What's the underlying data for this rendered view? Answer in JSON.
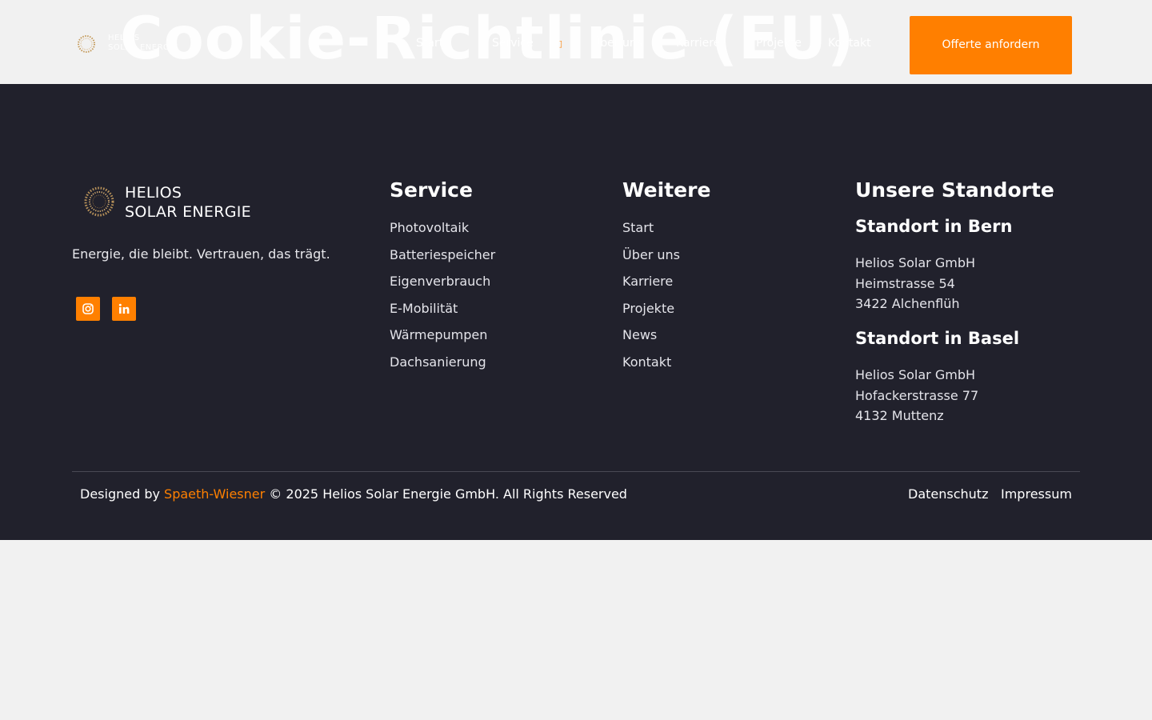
{
  "header": {
    "logo_text_line1": "HELIOS",
    "logo_text_line2": "SOLAR ENERGIE",
    "page_title": "Cookie-Richtlinie (EU)",
    "nav": [
      "Start",
      "Service",
      "Über uns",
      "Karriere",
      "Projekte",
      "Kontakt"
    ],
    "nav_dropdown_icon": "chevron-down-icon",
    "cta_label": "Offerte anfordern"
  },
  "footer": {
    "logo_line1": "HELIOS",
    "logo_line2": "SOLAR ENERGIE",
    "tagline": "Energie, die bleibt. Vertrauen, das trägt.",
    "social": [
      "instagram-icon",
      "linkedin-icon"
    ],
    "service": {
      "heading": "Service",
      "items": [
        "Photovoltaik",
        "Batteriespeicher",
        "Eigenverbrauch",
        "E-Mobilität",
        "Wärmepumpen",
        "Dachsanierung"
      ]
    },
    "weitere": {
      "heading": "Weitere",
      "items": [
        "Start",
        "Über uns",
        "Karriere",
        "Projekte",
        "News",
        "Kontakt"
      ]
    },
    "standorte": {
      "heading": "Unsere Standorte",
      "locations": [
        {
          "title": "Standort in Bern",
          "lines": [
            "Helios Solar GmbH",
            "Heimstrasse 54",
            "3422 Alchenflüh"
          ]
        },
        {
          "title": "Standort in Basel",
          "lines": [
            "Helios Solar GmbH",
            "Hofackerstrasse 77",
            "4132 Muttenz"
          ]
        }
      ]
    },
    "copyright_prefix": "Designed by",
    "copyright_brand": "Spaeth-Wiesner",
    "copyright_suffix": "© 2025 Helios Solar Energie GmbH. All Rights Reserved",
    "legal": [
      "Datenschutz",
      "Impressum"
    ]
  },
  "colors": {
    "accent": "#ff8000",
    "footer_bg": "#21212c",
    "page_bg": "#f1f1f1"
  }
}
